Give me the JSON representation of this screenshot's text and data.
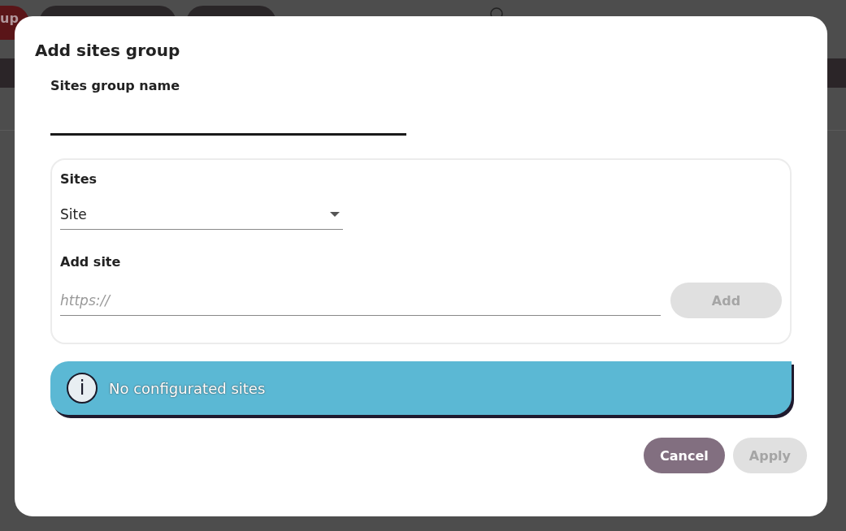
{
  "background": {
    "button": {
      "label": "up"
    }
  },
  "dialog": {
    "title": "Add sites group",
    "name_field": {
      "label": "Sites group name"
    },
    "sites_section": {
      "title": "Sites",
      "select": {
        "value": "Site"
      },
      "add_label": "Add site",
      "url_field": {
        "placeholder": "https://"
      },
      "add_button": {
        "label": "Add",
        "disabled": true
      }
    },
    "info": {
      "icon": "i",
      "message": "No configurated sites"
    },
    "buttons": [
      {
        "label": "Cancel",
        "kind": "secondary",
        "disabled": false
      },
      {
        "label": "Apply",
        "kind": "primary",
        "disabled": true
      }
    ]
  }
}
